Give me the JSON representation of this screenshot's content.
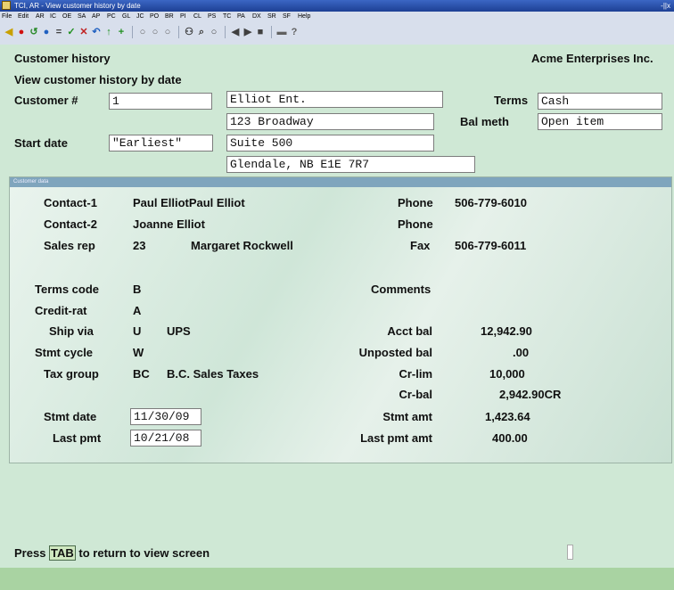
{
  "window": {
    "title": "TCI, AR - View customer history by date",
    "controls": "-||x"
  },
  "menu": [
    "File",
    "Edit",
    "AR",
    "IC",
    "OE",
    "SA",
    "AP",
    "PC",
    "GL",
    "JC",
    "PO",
    "BR",
    "PI",
    "CL",
    "PS",
    "TC",
    "PA",
    "DX",
    "SR",
    "SF",
    "Help"
  ],
  "toolbar_icons": [
    "back-icon",
    "stop-icon",
    "refresh-icon",
    "circle-icon",
    "equals-icon",
    "check-icon",
    "x-icon",
    "undo-icon",
    "up-icon",
    "plus-icon",
    "circle1-icon",
    "circle2-icon",
    "circle3-icon",
    "binoculars-icon",
    "zoom-icon",
    "record-icon",
    "prev-icon",
    "next-icon",
    "page-icon",
    "print-icon",
    "help-icon"
  ],
  "header": {
    "screen_title": "Customer history",
    "subtitle": "View customer history by date",
    "company": "Acme Enterprises Inc."
  },
  "form": {
    "customer_label": "Customer #",
    "customer_value": "1",
    "name": "Elliot Ent.",
    "address1": "123 Broadway",
    "address2": "Suite 500",
    "city": "Glendale, NB   E1E 7R7",
    "start_date_label": "Start date",
    "start_date_value": "\"Earliest\"",
    "terms_label": "Terms",
    "terms_value": "Cash",
    "bal_meth_label": "Bal meth",
    "bal_meth_value": "Open item"
  },
  "customer_data": {
    "panel_title": "Customer data",
    "contact1_label": "Contact-1",
    "contact1_value": "Paul ElliotPaul Elliot",
    "contact2_label": "Contact-2",
    "contact2_value": "Joanne Elliot",
    "salesrep_label": "Sales rep",
    "salesrep_code": "23",
    "salesrep_name": "Margaret Rockwell",
    "phone1_label": "Phone",
    "phone1_value": "506-779-6010",
    "phone2_label": "Phone",
    "fax_label": "Fax",
    "fax_value": "506-779-6011",
    "terms_code_label": "Terms code",
    "terms_code_value": "B",
    "credit_label": "Credit-rat",
    "credit_value": "A",
    "shipvia_label": "Ship via",
    "shipvia_code": "U",
    "shipvia_name": "UPS",
    "stmt_cycle_label": "Stmt cycle",
    "stmt_cycle_value": "W",
    "tax_group_label": "Tax group",
    "tax_group_code": "BC",
    "tax_group_name": "B.C. Sales Taxes",
    "comments_label": "Comments",
    "acct_bal_label": "Acct bal",
    "acct_bal_value": "12,942.90",
    "unposted_label": "Unposted bal",
    "unposted_value": ".00",
    "crlim_label": "Cr-lim",
    "crlim_value": "10,000",
    "crbal_label": "Cr-bal",
    "crbal_value": "2,942.90CR",
    "stmt_date_label": "Stmt date",
    "stmt_date_value": "11/30/09",
    "last_pmt_label": "Last pmt",
    "last_pmt_value": "10/21/08",
    "stmt_amt_label": "Stmt amt",
    "stmt_amt_value": "1,423.64",
    "last_pmt_amt_label": "Last pmt amt",
    "last_pmt_amt_value": "400.00"
  },
  "status": {
    "prefix": "Press ",
    "key": "TAB",
    "suffix": " to return to view screen"
  }
}
